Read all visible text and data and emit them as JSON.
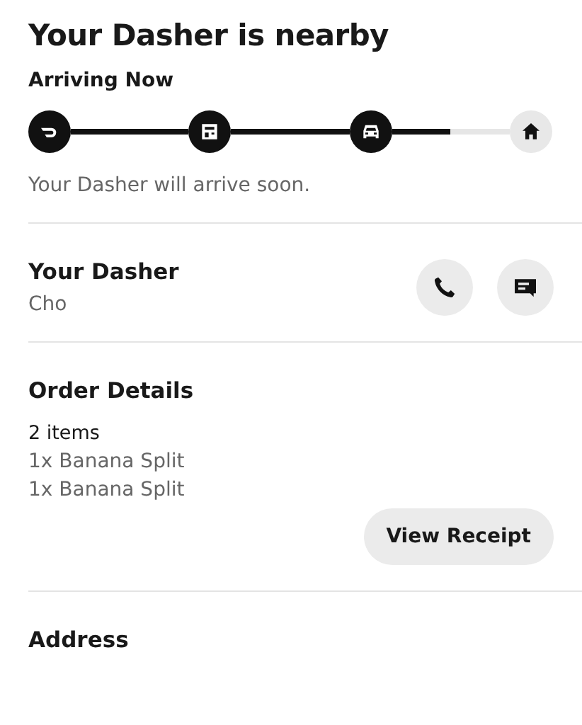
{
  "header": {
    "title": "Your Dasher is nearby",
    "status": "Arriving Now"
  },
  "progress": {
    "steps": [
      {
        "kind": "logo",
        "done": true
      },
      {
        "kind": "store",
        "done": true
      },
      {
        "kind": "car",
        "done": true
      },
      {
        "kind": "home",
        "done": false
      }
    ],
    "segments": [
      {
        "level": 1
      },
      {
        "level": 1
      },
      {
        "level": 0.5
      }
    ],
    "message": "Your Dasher will arrive soon."
  },
  "dasher": {
    "heading": "Your Dasher",
    "name": "Cho",
    "actions": [
      {
        "kind": "phone"
      },
      {
        "kind": "message"
      }
    ]
  },
  "order": {
    "heading": "Order Details",
    "count": "2 items",
    "items": [
      "1x Banana Split",
      "1x Banana Split"
    ],
    "button": "View Receipt"
  },
  "address": {
    "heading": "Address"
  }
}
